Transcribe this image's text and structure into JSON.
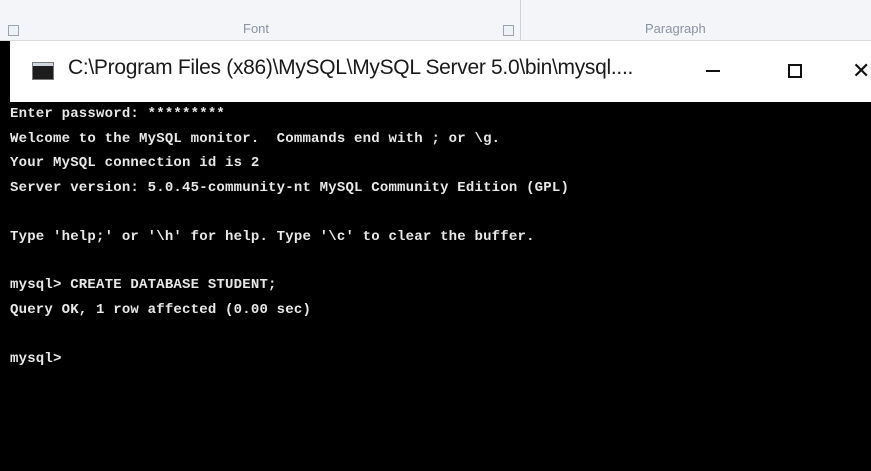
{
  "ribbon": {
    "group_font_label": "Font",
    "group_paragraph_label": "Paragraph"
  },
  "window": {
    "title": "C:\\Program Files (x86)\\MySQL\\MySQL Server 5.0\\bin\\mysql....",
    "minimize_icon": "minimize-icon",
    "maximize_icon": "maximize-icon",
    "close_icon": "close-icon",
    "close_glyph": "✕"
  },
  "console": {
    "lines": [
      "Enter password: *********",
      "Welcome to the MySQL monitor.  Commands end with ; or \\g.",
      "Your MySQL connection id is 2",
      "Server version: 5.0.45-community-nt MySQL Community Edition (GPL)",
      "Type 'help;' or '\\h' for help. Type '\\c' to clear the buffer.",
      "mysql> CREATE DATABASE STUDENT;",
      "Query OK, 1 row affected (0.00 sec)",
      "mysql>"
    ]
  }
}
